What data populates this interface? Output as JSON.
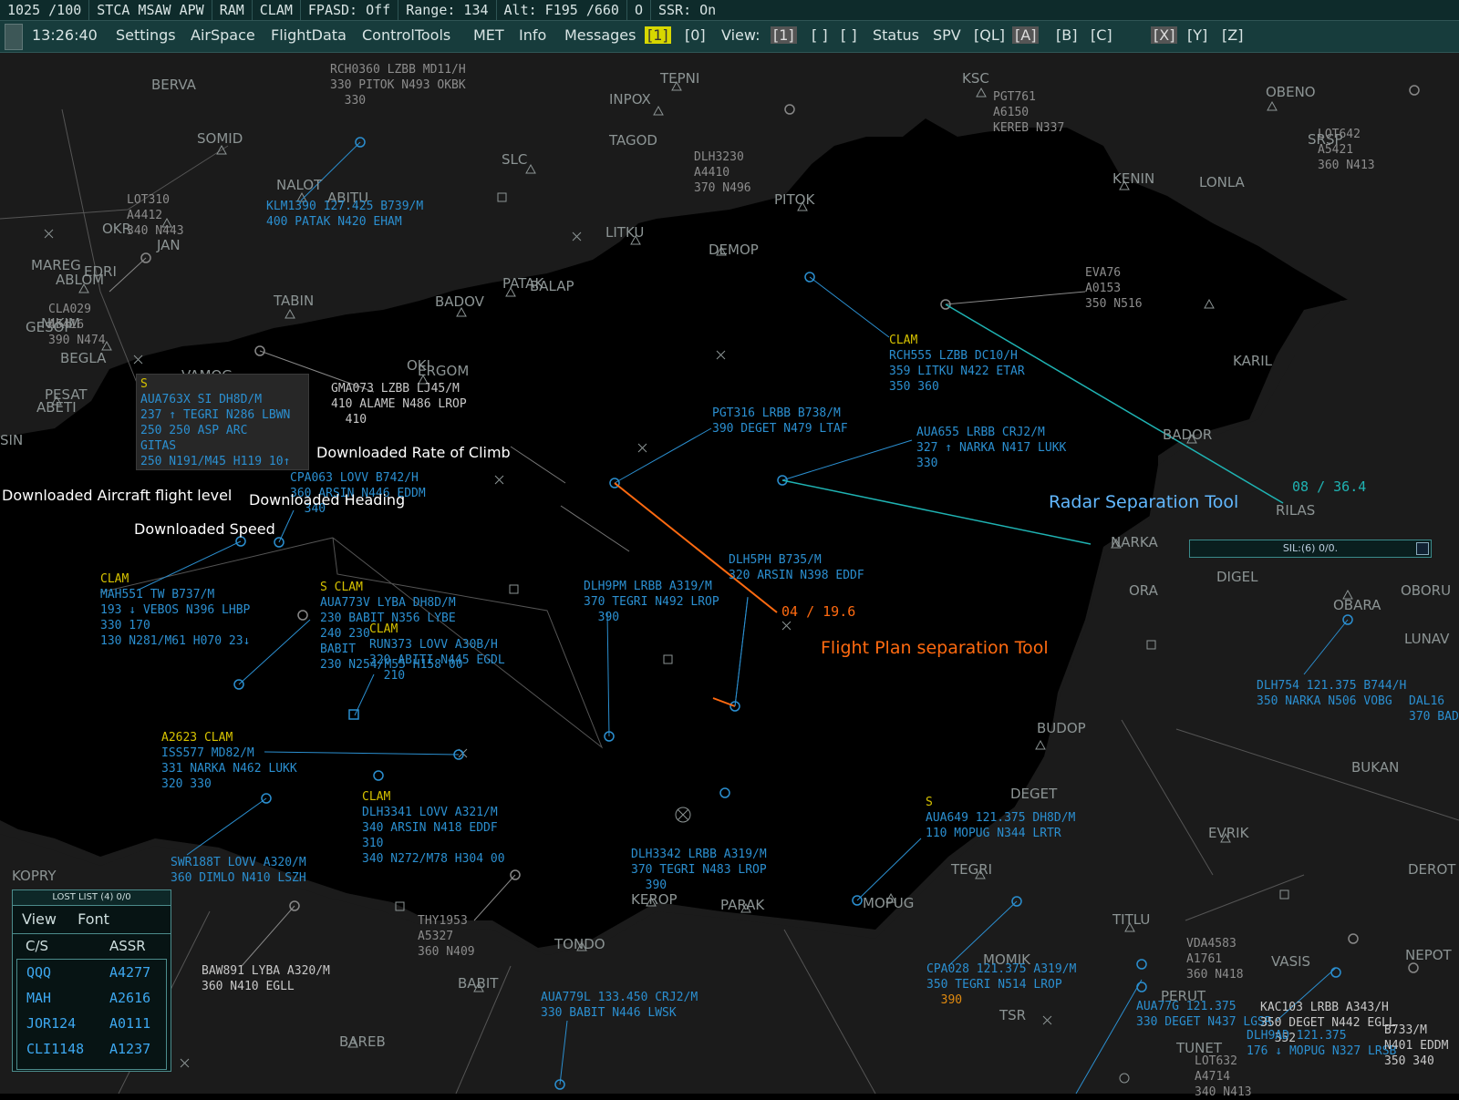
{
  "status_bar": {
    "qnh": "1025 /100",
    "alerts": "STCA MSAW APW",
    "ram": "RAM",
    "clam": "CLAM",
    "fpasd": "FPASD: Off",
    "range": "Range: 134",
    "alt": "Alt: F195 /660",
    "o_flag": "O",
    "ssr": "SSR: On"
  },
  "menu_bar": {
    "time": "13:26:40",
    "items": [
      "Settings",
      "AirSpace",
      "FlightData",
      "ControlTools",
      "MET",
      "Info",
      "Messages"
    ],
    "msg_buttons": [
      "[1]",
      "[0]"
    ],
    "view_label": "View:",
    "view_buttons": [
      "[1]",
      "[ ]",
      "[ ]"
    ],
    "status": "Status",
    "spv": "SPV",
    "ql": "[QL]",
    "abc": [
      "[A]",
      "[B]",
      "[C]"
    ],
    "xyz": [
      "[X]",
      "[Y]",
      "[Z]"
    ]
  },
  "fixes": [
    "BERVA",
    "SOMID",
    "NALOT",
    "ABITU",
    "TEPNI",
    "INPOX",
    "TAGOD",
    "SLC",
    "LITKU",
    "PITOK",
    "DEMOP",
    "KSC",
    "KENIN",
    "LONLA",
    "OBENO",
    "SRSP",
    "OKR",
    "JAN",
    "MAREG",
    "EDRI",
    "ABLOM",
    "TABIN",
    "BADOV",
    "PATAK",
    "BALAP",
    "NIKIM",
    "GESOP",
    "BEGLA",
    "VAMOG",
    "OKI",
    "ERGOM",
    "PESAT",
    "ABETI",
    "SIN",
    "KARIL",
    "BADOR",
    "RILAS",
    "NARKA",
    "DIGEL",
    "OBORU",
    "ORA",
    "OBARA",
    "LUNAV",
    "BUDOP",
    "BUKAN",
    "DEGET",
    "EVRIK",
    "DEROT",
    "TEGRI",
    "MOPUG",
    "KEROP",
    "PARAK",
    "TONDO",
    "TITLU",
    "MOMIK",
    "VASIS",
    "PERUT",
    "NEPOT",
    "TSR",
    "TUNET",
    "BABIT",
    "BAREB",
    "KOPRY",
    "KEREB"
  ],
  "tracks": [
    {
      "id": "rch0360",
      "lines": [
        "RCH0360 LZBB MD11/H",
        "330 PITOK N493 OKBK",
        "  330"
      ]
    },
    {
      "id": "klm1390",
      "lines": [
        "KLM1390 127.425 B739/M",
        "400 PATAK N420 EHAM"
      ]
    },
    {
      "id": "dlh3230",
      "lines": [
        "DLH3230",
        "A4410",
        "370 N496"
      ]
    },
    {
      "id": "pgt761",
      "lines": [
        "PGT761",
        "A6150",
        "KEREB N337"
      ]
    },
    {
      "id": "lot642",
      "lines": [
        "LOT642",
        "A5421",
        "360 N413"
      ]
    },
    {
      "id": "lot310",
      "lines": [
        "LOT310",
        "A4412",
        "340 N443"
      ]
    },
    {
      "id": "cla029",
      "lines": [
        "CLA029",
        "A5416",
        "390 N474"
      ]
    },
    {
      "id": "eva76",
      "lines": [
        "EVA76",
        "A0153",
        "350 N516"
      ]
    },
    {
      "id": "rch555",
      "lines": [
        "CLAM",
        "RCH555 LZBB DC10/H",
        "359 LITKU N422 ETAR",
        "350 360"
      ]
    },
    {
      "id": "aua763x",
      "lines": [
        "S",
        "AUA763X SI DH8D/M",
        "237 ↑ TEGRI N286 LBWN",
        "250 250 ASP ARC",
        "GITAS",
        "250 N191/M45 H119 10↑"
      ]
    },
    {
      "id": "gma073",
      "lines": [
        "GMA073 LZBB LJ45/M",
        "410 ALAME N486 LROP",
        "  410"
      ]
    },
    {
      "id": "pgt316",
      "lines": [
        "PGT316 LRBB B738/M",
        "390 DEGET N479 LTAF"
      ]
    },
    {
      "id": "aua655",
      "lines": [
        "AUA655 LRBB CRJ2/M",
        "327 ↑ NARKA N417 LUKK",
        "330"
      ]
    },
    {
      "id": "cpa063",
      "lines": [
        "CPA063 LOVV B742/H",
        "360 ARSIN N446 EDDM",
        "  340"
      ]
    },
    {
      "id": "dlh5ph",
      "lines": [
        "DLH5PH B735/M",
        "320 ARSIN N398 EDDF"
      ]
    },
    {
      "id": "dlh9pm",
      "lines": [
        "DLH9PM LRBB A319/M",
        "370 TEGRI N492 LROP",
        "  390"
      ]
    },
    {
      "id": "mah551",
      "lines": [
        "CLAM",
        "MAH551 TW B737/M",
        "193 ↓ VEBOS N396 LHBP",
        "330 170",
        "130 N281/M61 H070 23↓"
      ]
    },
    {
      "id": "aua773v",
      "lines": [
        "S CLAM",
        "AUA773V LYBA DH8D/M",
        "230 BABIT N356 LYBE",
        "240 230",
        "BABIT",
        "230 N254/M55 H158 00"
      ]
    },
    {
      "id": "run373",
      "lines": [
        "CLAM",
        "RUN373 LOVV A30B/H",
        "320 ABITI N445 EGDL",
        "  210"
      ]
    },
    {
      "id": "iss577",
      "lines": [
        "A2623 CLAM",
        "ISS577 MD82/M",
        "331 NARKA N462 LUKK",
        "320 330"
      ]
    },
    {
      "id": "dlh3341",
      "lines": [
        "CLAM",
        "DLH3341 LOVV A321/M",
        "340 ARSIN N418 EDDF",
        "310",
        "340 N272/M78 H304 00"
      ]
    },
    {
      "id": "swr188t",
      "lines": [
        "SWR188T LOVV A320/M",
        "360 DIMLO N410 LSZH"
      ]
    },
    {
      "id": "dlh3342",
      "lines": [
        "DLH3342 LRBB A319/M",
        "370 TEGRI N483 LROP",
        "  390"
      ]
    },
    {
      "id": "aua649",
      "lines": [
        "S",
        "AUA649 121.375 DH8D/M",
        "110 MOPUG N344 LRTR"
      ]
    },
    {
      "id": "dlh754",
      "lines": [
        "DLH754 121.375 B744/H",
        "350 NARKA N506 VOBG"
      ]
    },
    {
      "id": "dal16",
      "lines": [
        "DAL16",
        "370 BAD"
      ]
    },
    {
      "id": "thy1953",
      "lines": [
        "THY1953",
        "A5327",
        "360 N409"
      ]
    },
    {
      "id": "baw891",
      "lines": [
        "BAW891 LYBA A320/M",
        "360 N410 EGLL"
      ]
    },
    {
      "id": "cpa028",
      "lines": [
        "CPA028 121.375 A319/M",
        "350 TEGRI N514 LROP",
        "  390"
      ]
    },
    {
      "id": "vda4583",
      "lines": [
        "VDA4583",
        "A1761",
        "360 N418"
      ]
    },
    {
      "id": "aua779l",
      "lines": [
        "AUA779L 133.450 CRJ2/M",
        "330 BABIT N446 LWSK"
      ]
    },
    {
      "id": "aua77g",
      "lines": [
        "AUA77G 121.375",
        "330 DEGET N437 LGSR"
      ]
    },
    {
      "id": "kac103",
      "lines": [
        "KAC103 LRBB A343/H",
        "350 DEGET N442 EGLL",
        "  352"
      ]
    },
    {
      "id": "dlh9ad",
      "lines": [
        "DLH9AD 121.375",
        "176 ↓ MOPUG N327 LRSB"
      ]
    },
    {
      "id": "b733",
      "lines": [
        "B733/M",
        "N401 EDDM",
        "350 340"
      ]
    },
    {
      "id": "lot632",
      "lines": [
        "LOT632",
        "A4714",
        "340 N413"
      ]
    }
  ],
  "annotations": {
    "rate_of_climb": "Downloaded Rate of Climb",
    "flight_level": "Downloaded Aircraft flight level",
    "heading": "Downloaded Heading",
    "speed": "Downloaded Speed"
  },
  "tools": {
    "radar_separation_label": "Radar Separation Tool",
    "radar_separation_readout": "08 / 36.4",
    "fp_separation_label": "Flight Plan separation Tool",
    "fp_separation_readout": "04 / 19.6"
  },
  "sil_window": {
    "title": "SIL:(6) 0/0."
  },
  "lost_list": {
    "title": "LOST LIST (4) 0/0",
    "menu": [
      "View",
      "Font"
    ],
    "columns": [
      "C/S",
      "ASSR"
    ],
    "rows": [
      {
        "cs": "QQQ",
        "assr": "A4277"
      },
      {
        "cs": "MAH",
        "assr": "A2616"
      },
      {
        "cs": "JOR124",
        "assr": "A0111"
      },
      {
        "cs": "CLI1148",
        "assr": "A1237"
      }
    ]
  },
  "colors": {
    "sector": "#000000",
    "background": "#1b1b1b",
    "track": "#2b8fd0",
    "clam": "#d6c200",
    "radar_tool": "#1fb3b3",
    "fp_tool": "#ff6a10"
  }
}
